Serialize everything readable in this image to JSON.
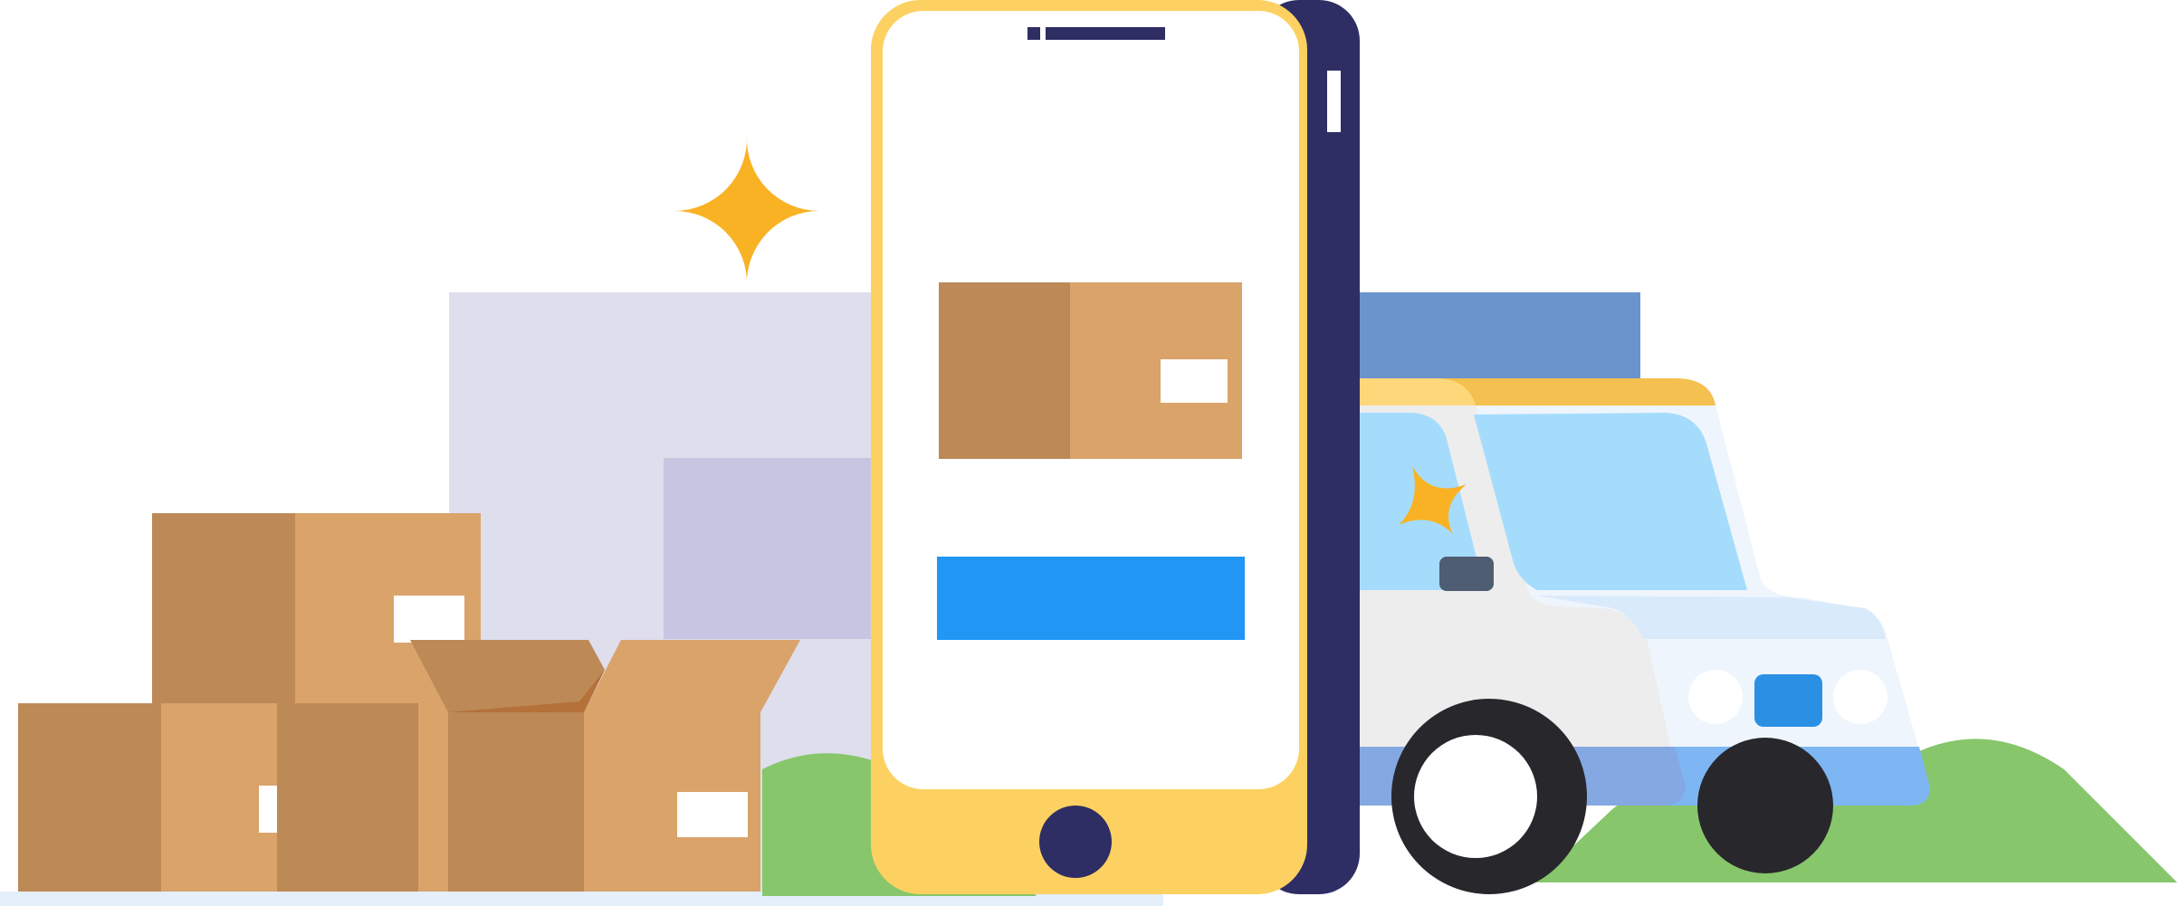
{
  "illustration": {
    "subject": "delivery-app-illustration",
    "colors": {
      "phone_body": "#2e2e64",
      "phone_bezel": "#fdd161",
      "screen": "#ffffff",
      "cta_button": "#2196f5",
      "box_light": "#d9a36a",
      "box_dark": "#bd8956",
      "box_fold": "#b5713a",
      "label": "#ffffff",
      "sparkle": "#f9b224",
      "building_light": "#dedeed",
      "building_mid": "#c6c6e2",
      "building_blue": "#6b93cc",
      "hill": "#87c66b",
      "van_roof": "#f4c04f",
      "van_roof_light": "#fdd77a",
      "van_body": "#eef5fd",
      "van_body_grey": "#ededed",
      "van_window": "#a5dcfc",
      "van_stripe": "#7eb6f4",
      "van_stripe_dark": "#84a8e2",
      "van_handle": "#4f5d72",
      "van_light_blue": "#2b90e3",
      "wheel": "#28272c",
      "hubcap": "#ffffff",
      "ground": "#e4effa"
    }
  }
}
